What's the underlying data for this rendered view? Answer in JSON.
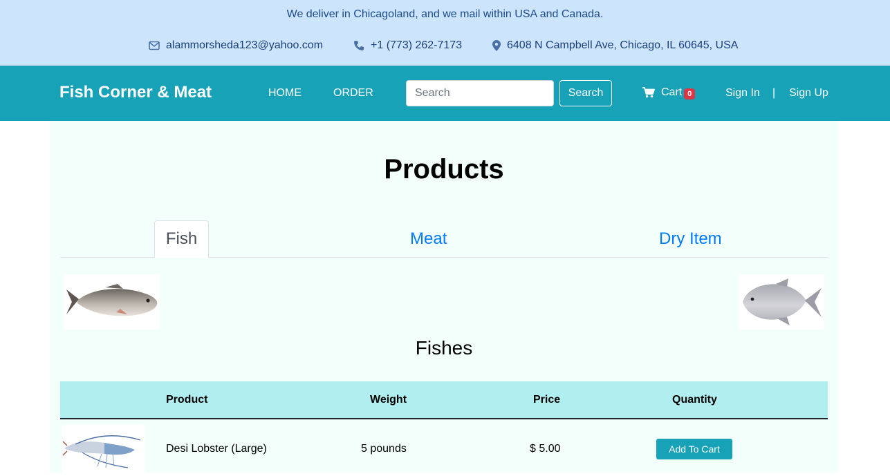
{
  "topbar": {
    "deliver_text": "We deliver in Chicagoland, and we mail within USA and Canada.",
    "email": "alammorsheda123@yahoo.com",
    "phone": "+1 (773) 262-7173",
    "address": "6408 N Campbell Ave, Chicago, IL 60645, USA",
    "icons": [
      "envelope-icon",
      "phone-icon",
      "map-marker-icon"
    ],
    "background": "#cce5fd"
  },
  "navbar": {
    "brand": "Fish Corner & Meat",
    "links": [
      "HOME",
      "ORDER"
    ],
    "search_placeholder": "Search",
    "search_button": "Search",
    "cart_label": "Cart",
    "cart_count": "0",
    "sign_in": "Sign In",
    "separator": "|",
    "sign_up": "Sign Up",
    "background": "#17a2b8"
  },
  "main": {
    "title": "Products",
    "tabs": [
      {
        "label": "Fish",
        "active": true
      },
      {
        "label": "Meat",
        "active": false
      },
      {
        "label": "Dry Item",
        "active": false
      }
    ],
    "section_title": "Fishes",
    "table": {
      "headers": [
        "Product",
        "Weight",
        "Price",
        "Quantity"
      ],
      "rows": [
        {
          "product": "Desi Lobster (Large)",
          "weight": "5 pounds",
          "price": "$ 5.00",
          "action": "Add To Cart"
        }
      ]
    },
    "background": "#f3fffa"
  }
}
